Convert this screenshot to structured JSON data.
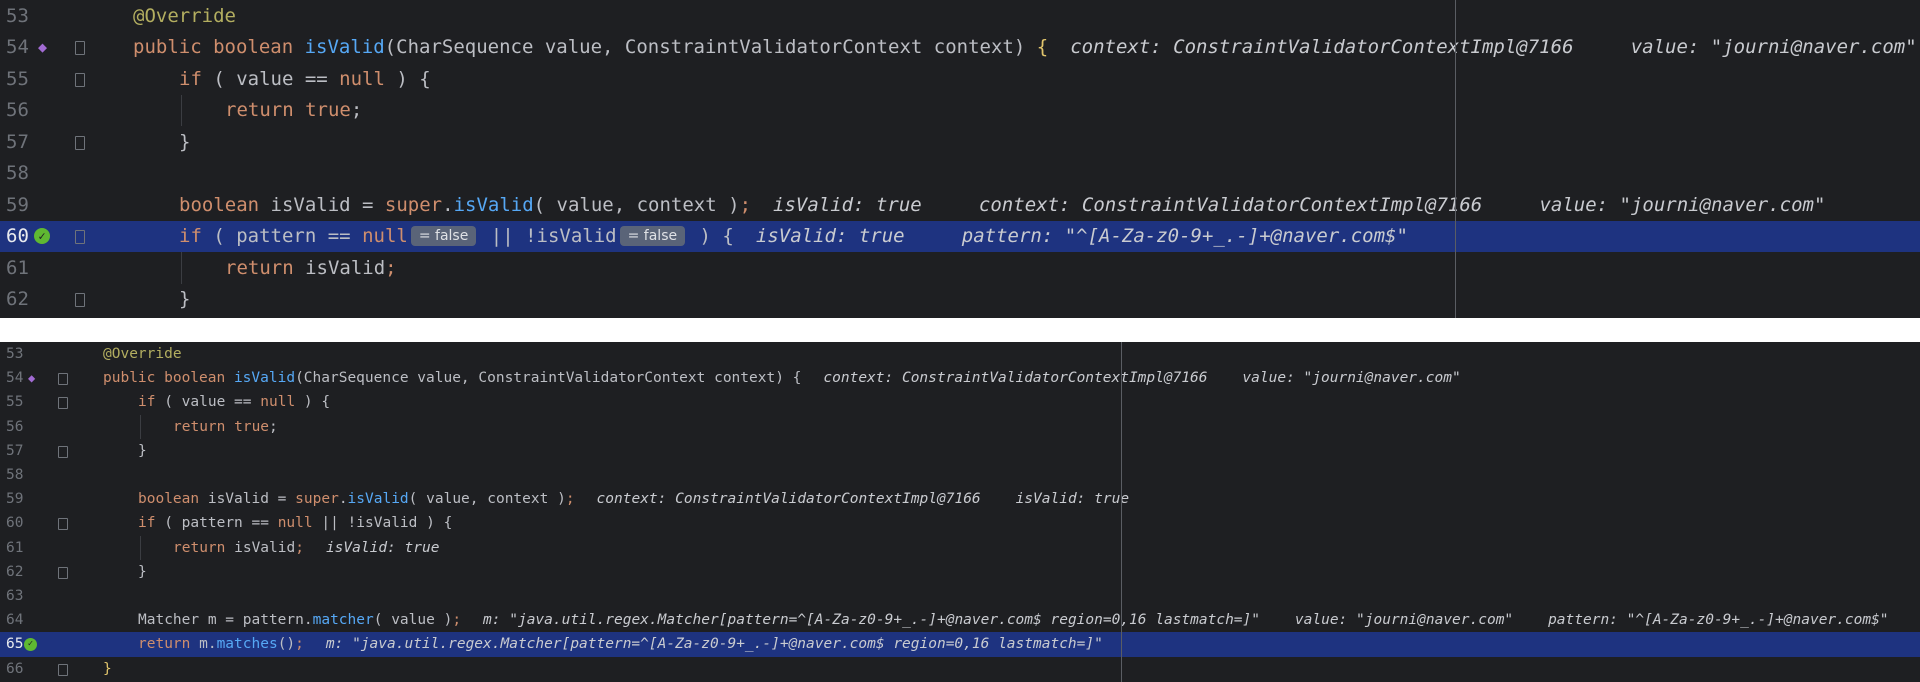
{
  "top": {
    "lines": [
      {
        "ln": "53",
        "tokens": [
          [
            "ann",
            "@Override"
          ]
        ]
      },
      {
        "ln": "54",
        "tokens": [
          [
            "kw",
            "public boolean "
          ],
          [
            "fn",
            "isValid"
          ],
          [
            "br",
            "("
          ],
          [
            "id",
            "CharSequence value, ConstraintValidatorContext context"
          ],
          [
            "br",
            ") "
          ],
          [
            "br-y",
            "{"
          ]
        ],
        "hint": "context: ConstraintValidatorContextImpl@7166     value: \"journi@naver.com\""
      },
      {
        "ln": "55",
        "tokens": [
          [
            "kw",
            "if "
          ],
          [
            "br",
            "( "
          ],
          [
            "id",
            "value == "
          ],
          [
            "kw",
            "null "
          ],
          [
            "br",
            ") {"
          ]
        ]
      },
      {
        "ln": "56",
        "tokens": [
          [
            "kw",
            "return true"
          ],
          [
            "id",
            ";"
          ]
        ]
      },
      {
        "ln": "57",
        "tokens": [
          [
            "br",
            "}"
          ]
        ]
      },
      {
        "ln": "58",
        "tokens": []
      },
      {
        "ln": "59",
        "tokens": [
          [
            "kw",
            "boolean "
          ],
          [
            "id",
            "isValid = "
          ],
          [
            "kw",
            "super"
          ],
          [
            "id",
            "."
          ],
          [
            "fn",
            "isValid"
          ],
          [
            "br",
            "( "
          ],
          [
            "id",
            "value, context "
          ],
          [
            "br",
            ")"
          ],
          [
            "kw",
            ";"
          ]
        ],
        "hint": "isValid: true     context: ConstraintValidatorContextImpl@7166     value: \"journi@naver.com\""
      },
      {
        "ln": "60",
        "tokens": [
          [
            "kw",
            "if "
          ],
          [
            "br",
            "( "
          ],
          [
            "id",
            "pattern == "
          ],
          [
            "kw",
            "null"
          ]
        ],
        "inlay1": "= false",
        "mid": " || !isValid",
        "inlay2": "= false",
        "tail": " ) {",
        "hint": "isValid: true     pattern: \"^[A-Za-z0-9+_.-]+@naver.com$\""
      },
      {
        "ln": "61",
        "tokens": [
          [
            "kw",
            "return "
          ],
          [
            "id",
            "isValid"
          ],
          [
            "kw",
            ";"
          ]
        ]
      },
      {
        "ln": "62",
        "tokens": [
          [
            "br",
            "}"
          ]
        ]
      }
    ]
  },
  "bottom": {
    "lines": [
      {
        "ln": "53",
        "tokens": [
          [
            "ann",
            "@Override"
          ]
        ]
      },
      {
        "ln": "54",
        "tokens": [
          [
            "kw",
            "public boolean "
          ],
          [
            "fn",
            "isValid"
          ],
          [
            "br",
            "("
          ],
          [
            "id",
            "CharSequence value, ConstraintValidatorContext context"
          ],
          [
            "br",
            ") {"
          ]
        ],
        "hint": "context: ConstraintValidatorContextImpl@7166    value: \"journi@naver.com\""
      },
      {
        "ln": "55",
        "tokens": [
          [
            "kw",
            "if "
          ],
          [
            "br",
            "( "
          ],
          [
            "id",
            "value == "
          ],
          [
            "kw",
            "null "
          ],
          [
            "br",
            ") {"
          ]
        ]
      },
      {
        "ln": "56",
        "tokens": [
          [
            "kw",
            "return true"
          ],
          [
            "id",
            ";"
          ]
        ]
      },
      {
        "ln": "57",
        "tokens": [
          [
            "br",
            "}"
          ]
        ]
      },
      {
        "ln": "58",
        "tokens": []
      },
      {
        "ln": "59",
        "tokens": [
          [
            "kw",
            "boolean "
          ],
          [
            "id",
            "isValid = "
          ],
          [
            "kw",
            "super"
          ],
          [
            "id",
            "."
          ],
          [
            "fn",
            "isValid"
          ],
          [
            "br",
            "( "
          ],
          [
            "id",
            "value, context "
          ],
          [
            "br",
            ")"
          ],
          [
            "kw",
            ";"
          ]
        ],
        "hint": "context: ConstraintValidatorContextImpl@7166    isValid: true"
      },
      {
        "ln": "60",
        "tokens": [
          [
            "kw",
            "if "
          ],
          [
            "br",
            "( "
          ],
          [
            "id",
            "pattern == "
          ],
          [
            "kw",
            "null "
          ],
          [
            "id",
            "|| !isValid "
          ],
          [
            "br",
            ") {"
          ]
        ]
      },
      {
        "ln": "61",
        "tokens": [
          [
            "kw",
            "return "
          ],
          [
            "id",
            "isValid"
          ],
          [
            "kw",
            ";"
          ]
        ],
        "hint": "isValid: true"
      },
      {
        "ln": "62",
        "tokens": [
          [
            "br",
            "}"
          ]
        ]
      },
      {
        "ln": "63",
        "tokens": []
      },
      {
        "ln": "64",
        "tokens": [
          [
            "id",
            "Matcher m = pattern."
          ],
          [
            "fn",
            "matcher"
          ],
          [
            "br",
            "( "
          ],
          [
            "id",
            "value "
          ],
          [
            "br",
            ")"
          ],
          [
            "kw",
            ";"
          ]
        ],
        "hint": "m: \"java.util.regex.Matcher[pattern=^[A-Za-z0-9+_.-]+@naver.com$ region=0,16 lastmatch=]\"    value: \"journi@naver.com\"    pattern: \"^[A-Za-z0-9+_.-]+@naver.com$\""
      },
      {
        "ln": "65",
        "tokens": [
          [
            "kw",
            "return "
          ],
          [
            "id",
            "m."
          ],
          [
            "fn",
            "matches"
          ],
          [
            "br",
            "()"
          ],
          [
            "kw",
            ";"
          ]
        ],
        "hint": "m: \"java.util.regex.Matcher[pattern=^[A-Za-z0-9+_.-]+@naver.com$ region=0,16 lastmatch=]\""
      },
      {
        "ln": "66",
        "tokens": [
          [
            "br-y",
            "}"
          ]
        ]
      }
    ]
  }
}
